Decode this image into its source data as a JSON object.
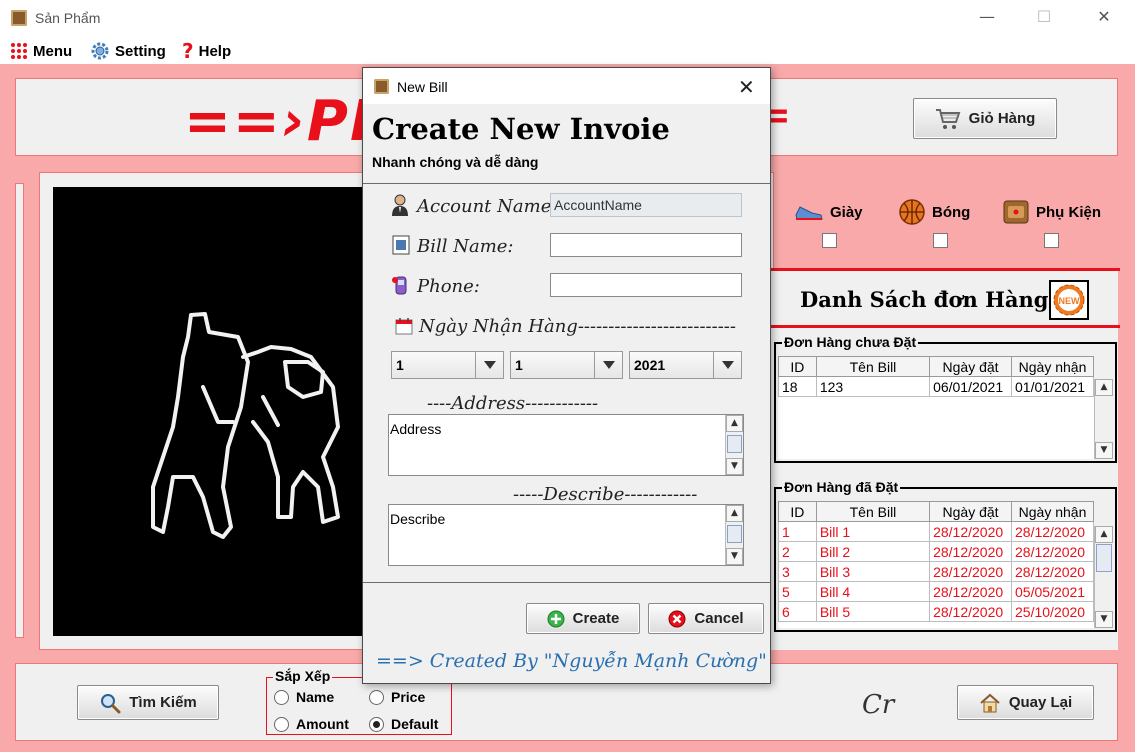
{
  "window": {
    "title": "Sản Phẩm",
    "minimize": "—",
    "maximize": "☐",
    "close": "✕"
  },
  "menubar": {
    "items": [
      {
        "label": "Menu"
      },
      {
        "label": "Setting"
      },
      {
        "label": "Help"
      }
    ]
  },
  "header": {
    "banner_visible": "==›PI",
    "banner_right": "=",
    "cart_button": "Giỏ Hàng"
  },
  "categories": [
    {
      "label": "Giày",
      "checked": false
    },
    {
      "label": "Bóng",
      "checked": false
    },
    {
      "label": "Phụ Kiện",
      "checked": false
    }
  ],
  "order_list": {
    "title": "Danh Sách đơn Hàng",
    "new_icon_text": "NEW",
    "pending": {
      "title": "Đơn Hàng chưa Đặt",
      "columns": [
        "ID",
        "Tên Bill",
        "Ngày đặt",
        "Ngày nhận"
      ],
      "rows": [
        [
          "18",
          "123",
          "06/01/2021",
          "01/01/2021"
        ]
      ]
    },
    "placed": {
      "title": "Đơn Hàng đã Đặt",
      "columns": [
        "ID",
        "Tên Bill",
        "Ngày đặt",
        "Ngày nhận"
      ],
      "rows": [
        [
          "1",
          "Bill 1",
          "28/12/2020",
          "28/12/2020"
        ],
        [
          "2",
          "Bill 2",
          "28/12/2020",
          "28/12/2020"
        ],
        [
          "3",
          "Bill 3",
          "28/12/2020",
          "28/12/2020"
        ],
        [
          "5",
          "Bill 4",
          "28/12/2020",
          "05/05/2021"
        ],
        [
          "6",
          "Bill 5",
          "28/12/2020",
          "25/10/2020"
        ]
      ]
    }
  },
  "bottom": {
    "search_button": "Tìm Kiếm",
    "sort": {
      "title": "Sắp Xếp",
      "options": [
        {
          "label": "Name",
          "selected": false
        },
        {
          "label": "Price",
          "selected": false
        },
        {
          "label": "Amount",
          "selected": false
        },
        {
          "label": "Default",
          "selected": true
        }
      ]
    },
    "mark": "Cr",
    "back_button": "Quay Lại"
  },
  "dialog": {
    "title": "New Bill",
    "heading": "Create New Invoie",
    "subheading": "Nhanh chóng và dễ dàng",
    "fields": {
      "account_label": "Account Name:",
      "account_value": "AccountName",
      "bill_label": "Bill Name:",
      "bill_value": "",
      "phone_label": "Phone:",
      "phone_value": "",
      "date_label": "Ngày Nhận Hàng--------------------------",
      "day": "1",
      "month": "1",
      "year": "2021",
      "address_label": "----Address------------",
      "address_value": "Address",
      "describe_label": "-----Describe------------",
      "describe_value": "Describe"
    },
    "create_button": "Create",
    "cancel_button": "Cancel",
    "credit": "==> Created By \"Nguyễn Mạnh Cường\""
  },
  "colors": {
    "frame": "#f9a9a9",
    "accent_red": "#e8101a",
    "credit_blue": "#2a6fb0"
  }
}
